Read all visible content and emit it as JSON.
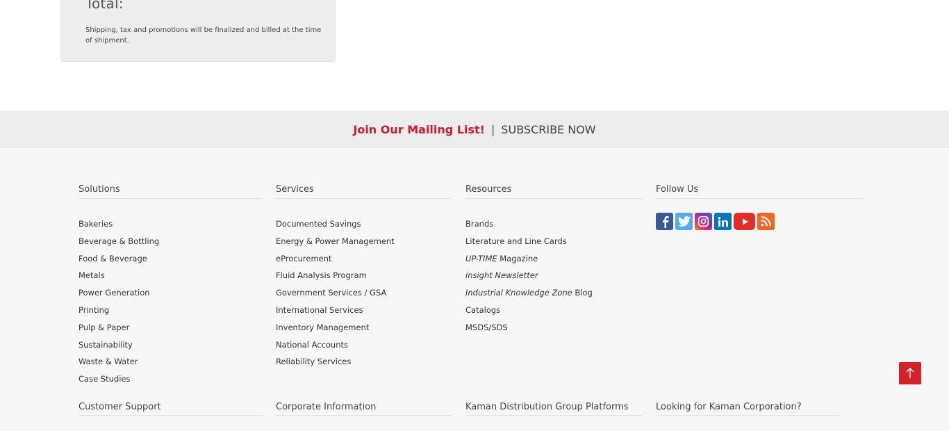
{
  "cart_summary": {
    "total_label": "Total:",
    "note": "Shipping, tax and promotions will be finalized and billed at the time of shipment."
  },
  "mailing": {
    "join_text": "Join Our Mailing List!",
    "separator": "|",
    "subscribe_text": "SUBSCRIBE NOW"
  },
  "footer": {
    "solutions": {
      "title": "Solutions",
      "items": [
        "Bakeries",
        "Beverage & Bottling",
        "Food & Beverage",
        "Metals",
        "Power Generation",
        "Printing",
        "Pulp & Paper",
        "Sustainability",
        "Waste & Water",
        "Case Studies"
      ]
    },
    "services": {
      "title": "Services",
      "items": [
        "Documented Savings",
        "Energy & Power Management",
        "eProcurement",
        "Fluid Analysis Program",
        "Government Services / GSA",
        "International Services",
        "Inventory Management",
        "National Accounts",
        "Reliability Services"
      ]
    },
    "resources": {
      "title": "Resources",
      "brands": "Brands",
      "literature": "Literature and Line Cards",
      "uptime_italic": "UP-TIME",
      "uptime_rest": " Magazine",
      "insight": "insight Newsletter",
      "ikz_italic": "Industrial Knowledge Zone",
      "ikz_rest": " Blog",
      "catalogs": "Catalogs",
      "msds": "MSDS/SDS"
    },
    "follow": {
      "title": "Follow Us",
      "icons": [
        "facebook-icon",
        "twitter-icon",
        "instagram-icon",
        "linkedin-icon",
        "youtube-icon",
        "rss-icon"
      ]
    },
    "bottom": {
      "customer_support": "Customer Support",
      "corporate_info": "Corporate Information",
      "platforms": "Kaman Distribution Group Platforms",
      "kaman_corp": "Looking for Kaman Corporation?"
    }
  },
  "colors": {
    "accent_red": "#c8202f",
    "footer_bg": "#f7f7f7",
    "bar_bg": "#ececec"
  }
}
